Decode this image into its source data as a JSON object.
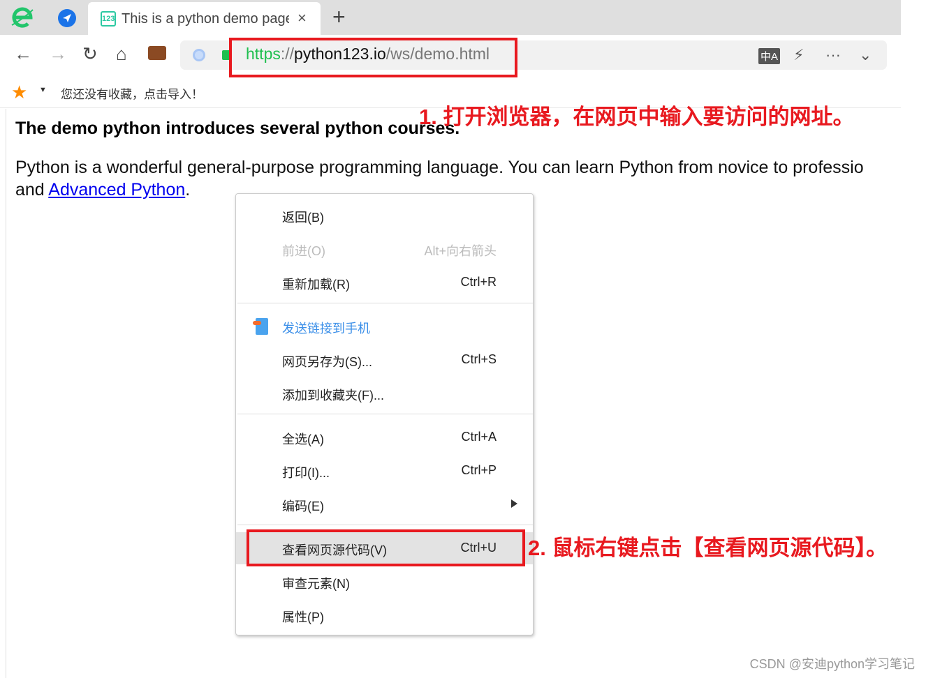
{
  "browser": {
    "tab": {
      "title": "This is a python demo page",
      "favicon": "123-icon",
      "close": "×"
    },
    "new_tab": "+",
    "url": {
      "scheme": "https",
      "sep": "://",
      "host": "python123.io",
      "path": "/ws/demo.html"
    },
    "bookmarks_prompt": "您还没有收藏，点击导入！"
  },
  "page": {
    "heading": "The demo python introduces several python courses.",
    "para_text": "Python is a wonderful general-purpose programming language. You can learn Python from novice to professio",
    "para_and": "and ",
    "link": "Advanced Python",
    "para_end": "."
  },
  "context_menu": {
    "items": [
      {
        "label": "返回(B)",
        "shortcut": ""
      },
      {
        "label": "前进(O)",
        "shortcut": "Alt+向右箭头",
        "disabled": true
      },
      {
        "label": "重新加载(R)",
        "shortcut": "Ctrl+R"
      },
      {
        "label": "发送链接到手机",
        "shortcut": ""
      },
      {
        "label": "网页另存为(S)...",
        "shortcut": "Ctrl+S"
      },
      {
        "label": "添加到收藏夹(F)...",
        "shortcut": ""
      },
      {
        "label": "全选(A)",
        "shortcut": "Ctrl+A"
      },
      {
        "label": "打印(I)...",
        "shortcut": "Ctrl+P"
      },
      {
        "label": "编码(E)",
        "shortcut": ""
      },
      {
        "label": "查看网页源代码(V)",
        "shortcut": "Ctrl+U",
        "highlighted": true
      },
      {
        "label": "审查元素(N)",
        "shortcut": ""
      },
      {
        "label": "属性(P)",
        "shortcut": ""
      }
    ]
  },
  "annotations": {
    "step1": "1. 打开浏览器，在网页中输入要访问的网址。",
    "step2": "2. 鼠标右键点击【查看网页源代码】。"
  },
  "watermark": "CSDN @安迪python学习笔记",
  "colors": {
    "annotation": "#e8191f",
    "link": "#0000ee",
    "secure": "#1fbf4f"
  }
}
